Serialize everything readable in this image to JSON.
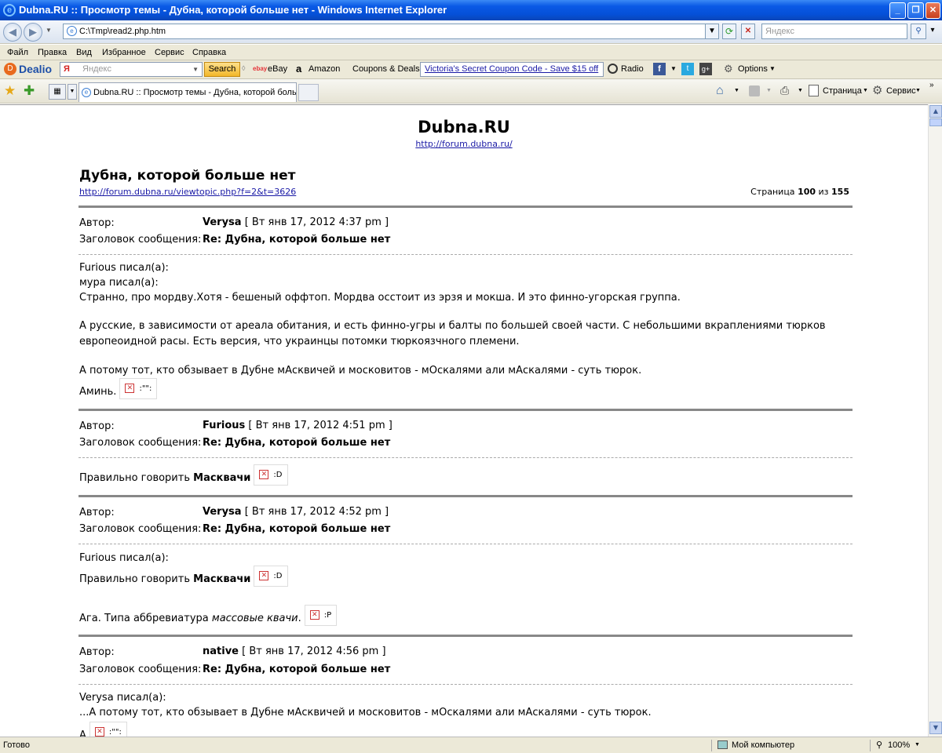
{
  "window": {
    "title": "Dubna.RU :: Просмотр темы - Дубна, которой больше нет - Windows Internet Explorer"
  },
  "nav": {
    "address": "C:\\Tmp\\read2.php.htm",
    "search_placeholder": "Яндекс"
  },
  "menu": [
    "Файл",
    "Правка",
    "Вид",
    "Избранное",
    "Сервис",
    "Справка"
  ],
  "toolbar": {
    "brand": "Dealio",
    "search_placeholder": "Яндекс",
    "search_button": "Search",
    "ebay": "eBay",
    "amazon": "Amazon",
    "coupons": "Coupons & Deals",
    "ad": "Victoria's Secret Coupon Code - Save $15 off",
    "radio": "Radio",
    "options": "Options"
  },
  "tabs": {
    "active": "Dubna.RU :: Просмотр темы - Дубна, которой больш...",
    "page_menu": "Страница",
    "tools_menu": "Сервис"
  },
  "status": {
    "text": "Готово",
    "zone": "Мой компьютер",
    "zoom": "100%"
  },
  "page": {
    "site_title": "Dubna.RU",
    "site_url": "http://forum.dubna.ru/",
    "topic_title": "Дубна, которой больше нет",
    "topic_url": "http://forum.dubna.ru/viewtopic.php?f=2&t=3626",
    "pager_prefix": "Страница ",
    "pager_current": "100",
    "pager_mid": " из ",
    "pager_total": "155",
    "author_label": "Автор:",
    "subject_label": "Заголовок сообщения:",
    "posts": [
      {
        "author": "Verysa",
        "date": "[ Вт янв 17, 2012 4:37 pm ]",
        "subject": "Re: Дубна, которой больше нет",
        "lines": [
          "Furious писал(а):",
          "мура писал(а):",
          "Странно, про мордву.Хотя - бешеный оффтоп. Мордва осстоит из эрзя и мокша. И это финно-угорская группа.",
          "А русские, в зависимости от ареала обитания, и есть финно-угры и балты по большей своей части. С небольшими вкраплениями тюрков",
          "европеоидной расы. Есть версия, что украинцы потомки тюркоязчного племени.",
          "А потому тот, кто обзывает в Дубне мАсквичей и московитов - мОскалями али мАскалями - суть тюрок.",
          "Аминь."
        ],
        "smile": ":\"\":"
      },
      {
        "author": "Furious",
        "date": "[ Вт янв 17, 2012 4:51 pm ]",
        "subject": "Re: Дубна, которой больше нет",
        "text": "Правильно говорить ",
        "bold": "Масквачи",
        "smile": ":D"
      },
      {
        "author": "Verysa",
        "date": "[ Вт янв 17, 2012 4:52 pm ]",
        "subject": "Re: Дубна, которой больше нет",
        "quote": "Furious писал(а):",
        "text": "Правильно говорить ",
        "bold": "Масквачи",
        "smile": ":D",
        "reply_text": "Ага. Типа аббревиатура ",
        "reply_italic": "массовые квачи",
        "reply_end": ".",
        "reply_smile": ":P"
      },
      {
        "author": "native",
        "date": "[ Вт янв 17, 2012 4:56 pm ]",
        "subject": "Re: Дубна, которой больше нет",
        "quote": "Verysa писал(а):",
        "text": "...А потому тот, кто обзывает в Дубне мАсквичей и московитов - мОскалями али мАскалями - суть тюрок.",
        "partial": "А",
        "smile": ":\"\":"
      }
    ]
  }
}
